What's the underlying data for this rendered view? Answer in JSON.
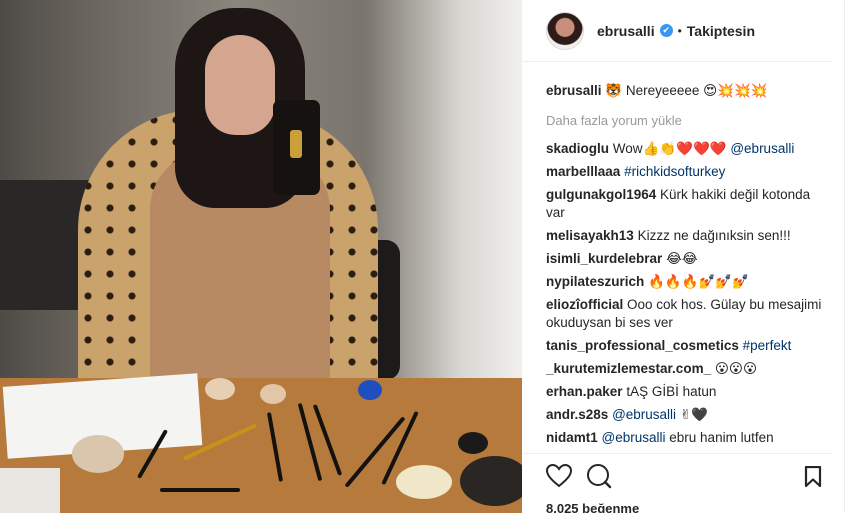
{
  "post": {
    "username": "ebrusalli",
    "verified_mark": "✔",
    "separator": "•",
    "follow_status": "Takiptesin",
    "caption_user": "ebrusalli",
    "caption_text": "🐯 Nereyeeeee 😍💥💥💥",
    "load_more": "Daha fazla yorum yükle",
    "likes": "8.025 beğenme"
  },
  "comments": [
    {
      "user": "skadioglu",
      "text": "Wow👍👏❤️❤️❤️ ",
      "tag": "@ebrusalli"
    },
    {
      "user": "marbelllaaa",
      "text": "",
      "tag": "#richkidsofturkey"
    },
    {
      "user": "gulgunakgol1964",
      "text": "Kürk hakiki değil kotonda var",
      "tag": ""
    },
    {
      "user": "melisayakh13",
      "text": "Kizzz ne dağınıksin sen!!!",
      "tag": ""
    },
    {
      "user": "isimli_kurdelebrar",
      "text": "😂😂",
      "tag": ""
    },
    {
      "user": "nypilateszurich",
      "text": "🔥🔥🔥💅💅💅",
      "tag": ""
    },
    {
      "user": "eliozîofficial",
      "text": "Ooo cok hos. Gülay bu mesajimi okuduysan bi ses ver",
      "tag": ""
    },
    {
      "user": "tanis_professional_cosmetics",
      "text": "",
      "tag": "#perfekt"
    },
    {
      "user": "_kurutemizlemestar.com_",
      "text": "😮😮😮",
      "tag": ""
    },
    {
      "user": "erhan.paker",
      "text": "tAŞ GİBİ hatun",
      "tag": ""
    },
    {
      "user": "andr.s28s",
      "text": "✌🖤",
      "tag": "@ebrusalli",
      "tag_first": true
    },
    {
      "user": "nidamt1",
      "text": "ebru hanim lutfen",
      "tag": "@ebrusalli",
      "tag_first": true
    }
  ],
  "icons": {
    "like": "heart-icon",
    "comment": "comment-icon",
    "save": "bookmark-icon"
  }
}
